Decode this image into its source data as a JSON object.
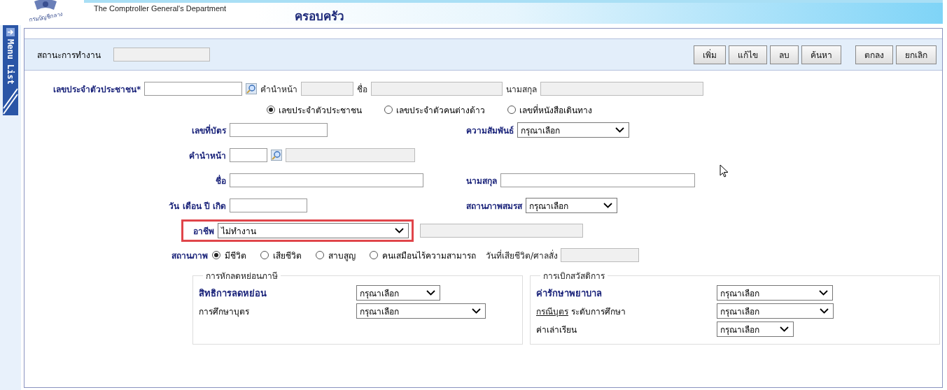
{
  "header": {
    "logo_text": "กรมบัญชีกลาง",
    "org": "The Comptroller General's Department",
    "title": "ครอบครัว"
  },
  "sidebar": {
    "label": "Menu List"
  },
  "toolbar": {
    "status_label": "สถานะการทำงาน",
    "record_buttons": [
      "เพิ่ม",
      "แก้ไข",
      "ลบ",
      "ค้นหา"
    ],
    "confirm_buttons": [
      "ตกลง",
      "ยกเลิก"
    ]
  },
  "id_row": {
    "label": "เลขประจำตัวประชาชน*",
    "prefix_label": "คำนำหน้า",
    "first_name_label": "ชื่อ",
    "last_name_label": "นามสกุล"
  },
  "id_types": [
    {
      "label": "เลขประจำตัวประชาชน",
      "selected": true
    },
    {
      "label": "เลขประจำตัวคนต่างด้าว",
      "selected": false
    },
    {
      "label": "เลขที่หนังสือเดินทาง",
      "selected": false
    }
  ],
  "card_no": {
    "label": "เลขที่บัตร"
  },
  "relationship": {
    "label": "ความสัมพันธ์",
    "value": "กรุณาเลือก"
  },
  "prefix": {
    "label": "คำนำหน้า"
  },
  "first_name": {
    "label": "ชื่อ"
  },
  "last_name": {
    "label": "นามสกุล"
  },
  "birth_date": {
    "label": "วัน เดือน ปี เกิด"
  },
  "marital_status": {
    "label": "สถานภาพสมรส",
    "value": "กรุณาเลือก"
  },
  "occupation": {
    "label": "อาชีพ",
    "value": "ไม่ทำงาน",
    "highlighted": true
  },
  "life_status": {
    "label": "สถานภาพ",
    "options": [
      {
        "label": "มีชีวิต",
        "selected": true
      },
      {
        "label": "เสียชีวิต",
        "selected": false
      },
      {
        "label": "สาบสูญ",
        "selected": false
      },
      {
        "label": "คนเสมือนไร้ความสามารถ",
        "selected": false
      }
    ],
    "death_date_label": "วันที่เสียชีวิต/ศาลสั่ง"
  },
  "tax_deduction": {
    "legend": "การหักลดหย่อนภาษี",
    "rows": [
      {
        "label": "สิทธิการลดหย่อน",
        "bold": true,
        "value": "กรุณาเลือก"
      },
      {
        "label": "การศึกษาบุตร",
        "bold": false,
        "value": "กรุณาเลือก"
      }
    ]
  },
  "welfare": {
    "legend": "การเบิกสวัสดิการ",
    "rows": [
      {
        "label": "ค่ารักษาพยาบาล",
        "bold": true,
        "value": "กรุณาเลือก"
      },
      {
        "link": "กรณีบุตร",
        "label": "ระดับการศึกษา",
        "bold": false,
        "value": "กรุณาเลือก"
      },
      {
        "label": "ค่าเล่าเรียน",
        "bold": false,
        "value": "กรุณาเลือก"
      }
    ]
  }
}
